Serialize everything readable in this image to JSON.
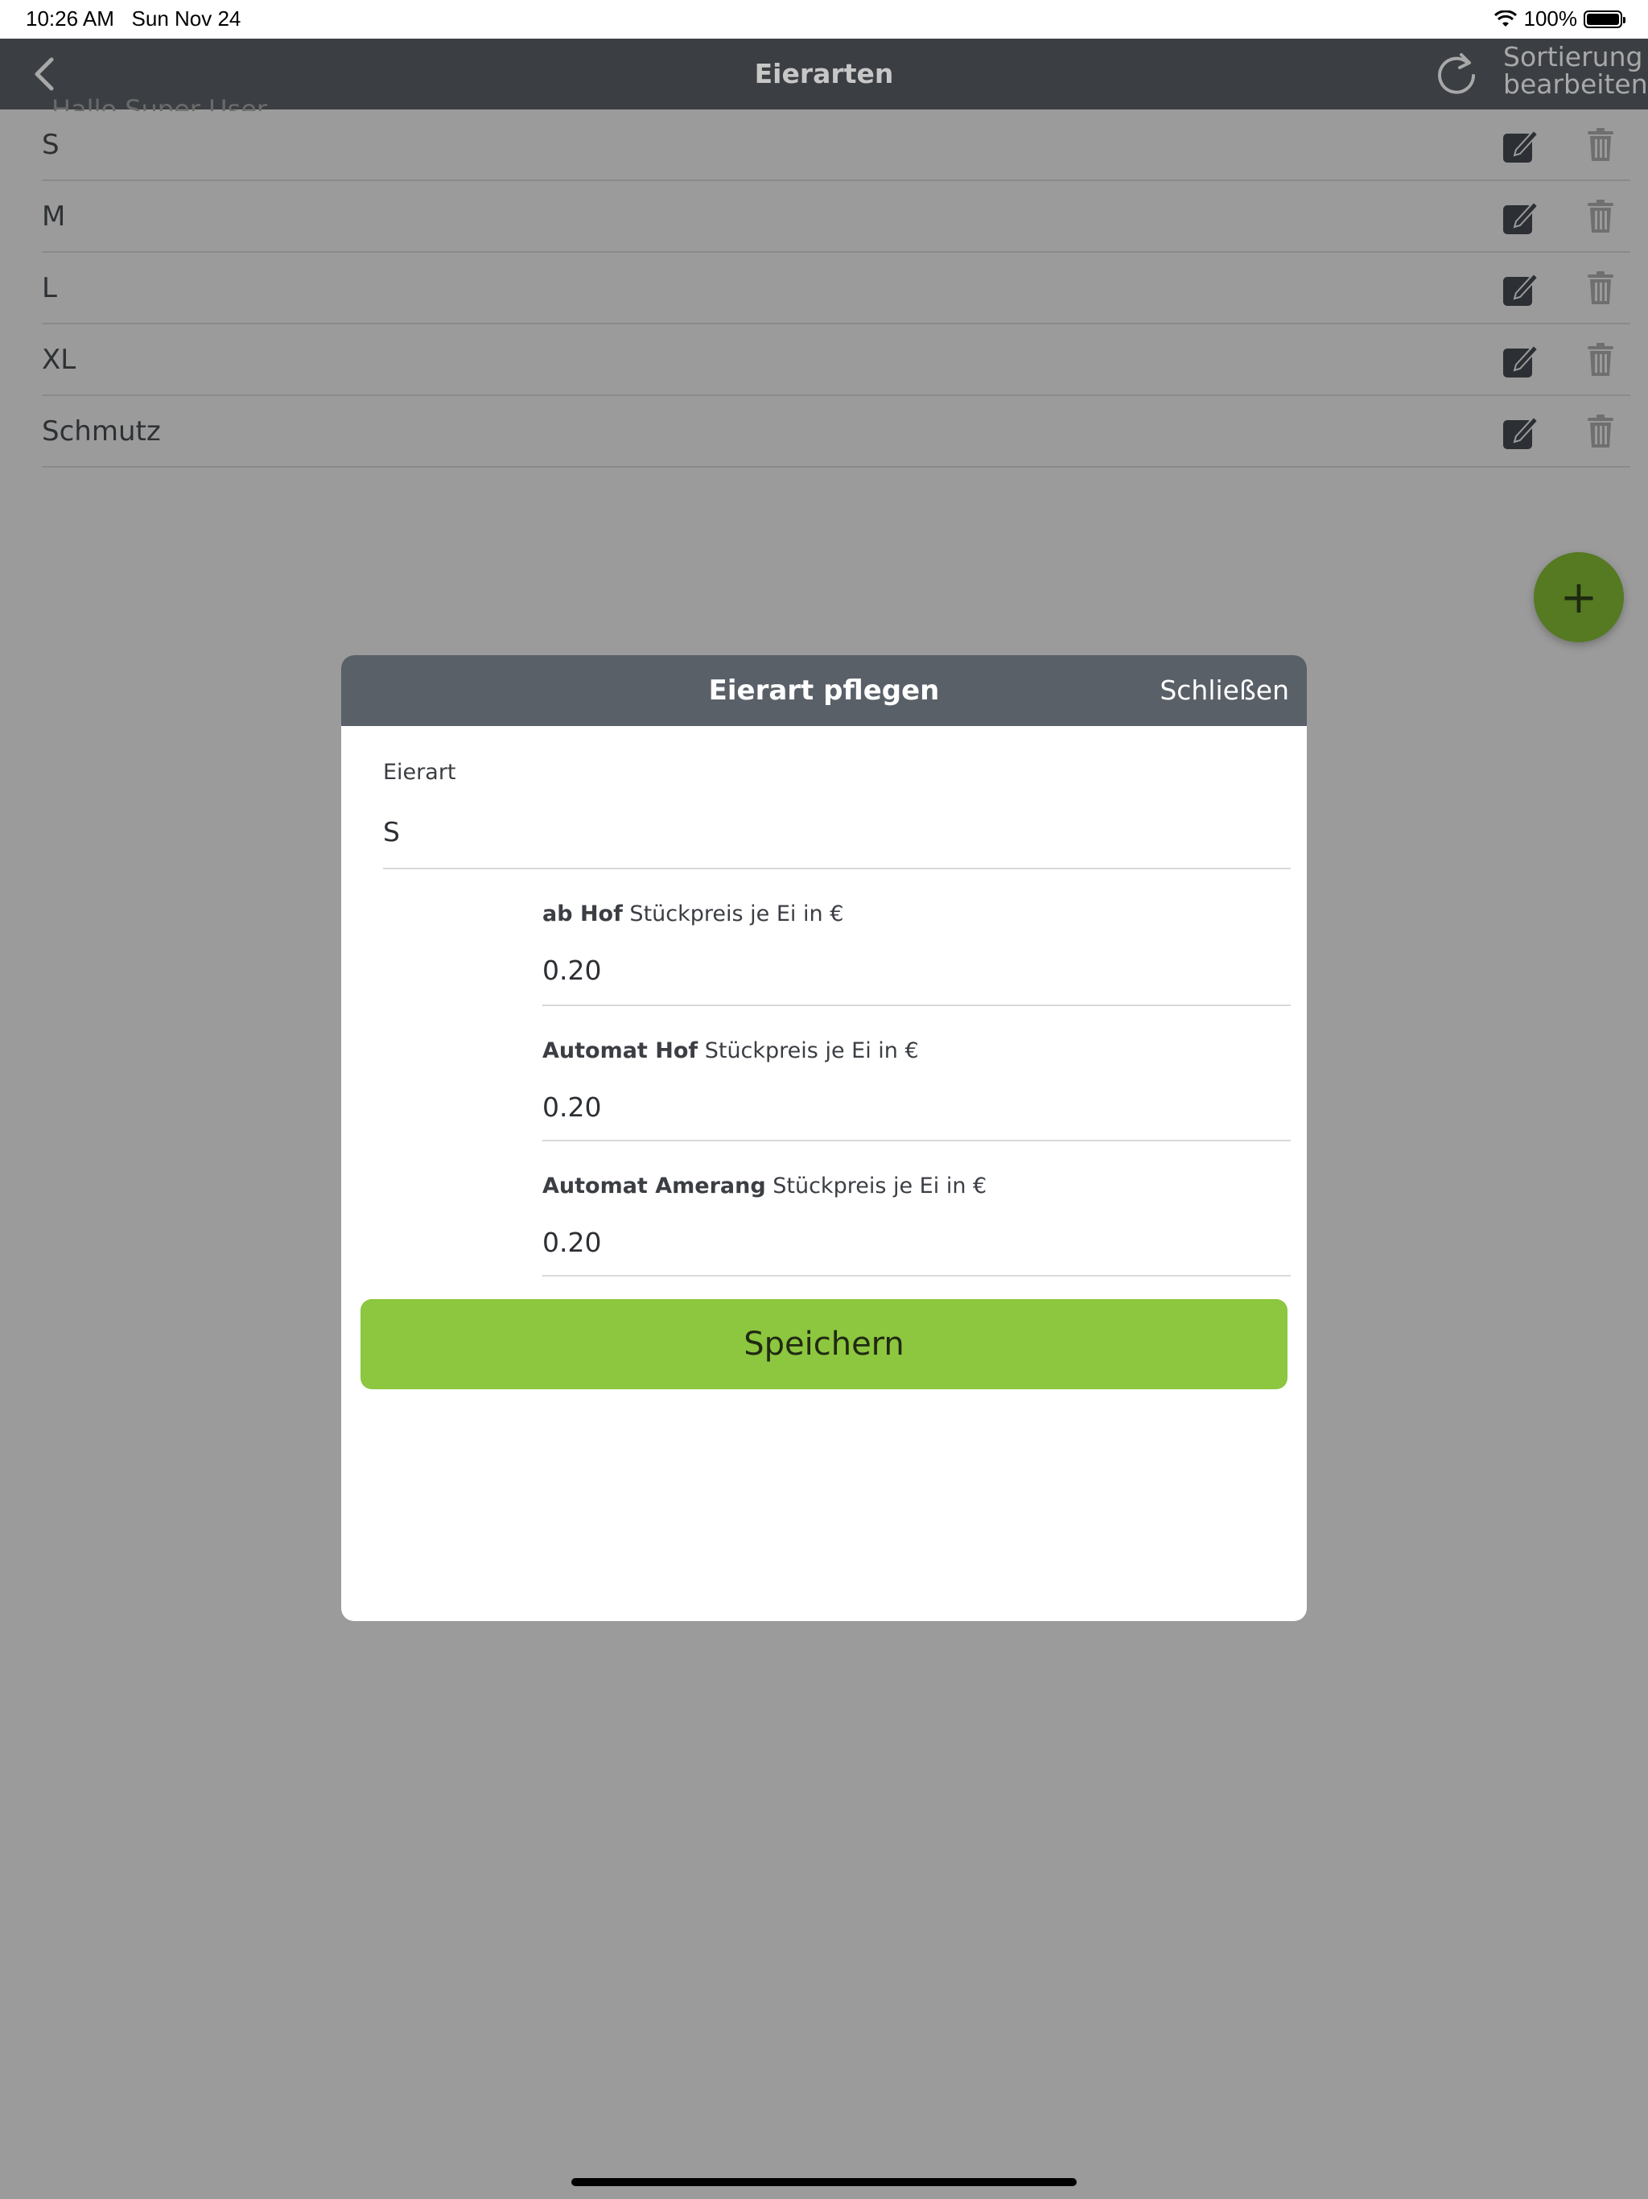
{
  "status_bar": {
    "time": "10:26 AM",
    "date": "Sun Nov 24",
    "battery": "100%"
  },
  "nav": {
    "title": "Eierarten",
    "sort_line1": "Sortierung",
    "sort_line2": "bearbeiten",
    "ghost_greeting": "Hallo Super User"
  },
  "list": {
    "items": [
      {
        "label": "S"
      },
      {
        "label": "M"
      },
      {
        "label": "L"
      },
      {
        "label": "XL"
      },
      {
        "label": "Schmutz"
      }
    ]
  },
  "fab": {
    "label": "+"
  },
  "modal": {
    "title": "Eierart pflegen",
    "close_label": "Schließen",
    "eierart": {
      "label": "Eierart",
      "value": "S"
    },
    "prices": [
      {
        "bold": "ab Hof",
        "rest": " Stückpreis je Ei in €",
        "value": "0.20"
      },
      {
        "bold": "Automat Hof",
        "rest": " Stückpreis je Ei in €",
        "value": "0.20"
      },
      {
        "bold": "Automat Amerang",
        "rest": " Stückpreis je Ei in €",
        "value": "0.20"
      }
    ],
    "save_label": "Speichern"
  }
}
